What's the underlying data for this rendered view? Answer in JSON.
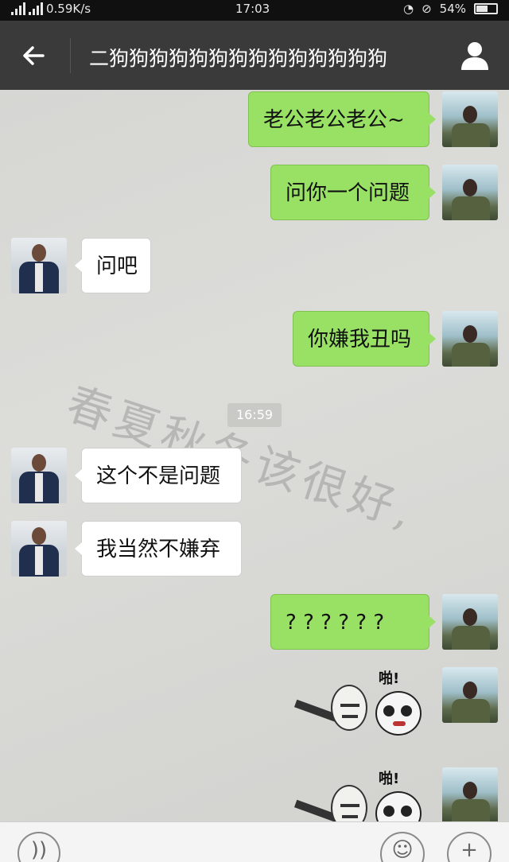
{
  "status_bar": {
    "network_speed": "0.59K/s",
    "time": "17:03",
    "battery": "54%",
    "icons": [
      "signal-icon",
      "signal-icon-2",
      "alarm-icon",
      "mute-icon",
      "battery-icon"
    ]
  },
  "header": {
    "back_icon": "arrow-left-icon",
    "title": "二狗狗狗狗狗狗狗狗狗狗狗狗狗狗",
    "profile_icon": "person-icon"
  },
  "chat": {
    "watermark": "春夏秋冬该很好,",
    "timestamp": "16:59",
    "messages": [
      {
        "from": "me",
        "text": "老公老公老公~"
      },
      {
        "from": "me",
        "text": "问你一个问题"
      },
      {
        "from": "other",
        "text": "问吧"
      },
      {
        "from": "me",
        "text": "你嫌我丑吗"
      },
      {
        "from": "other",
        "text": "这个不是问题"
      },
      {
        "from": "other",
        "text": "我当然不嫌弃"
      },
      {
        "from": "me",
        "text": "? ? ? ? ? ?"
      },
      {
        "from": "me",
        "sticker_text": "啪!"
      },
      {
        "from": "me",
        "sticker_text": "啪!"
      }
    ]
  },
  "input_bar": {
    "voice_icon": "voice-icon",
    "emoji_icon": "emoji-icon",
    "plus_icon": "plus-icon"
  }
}
